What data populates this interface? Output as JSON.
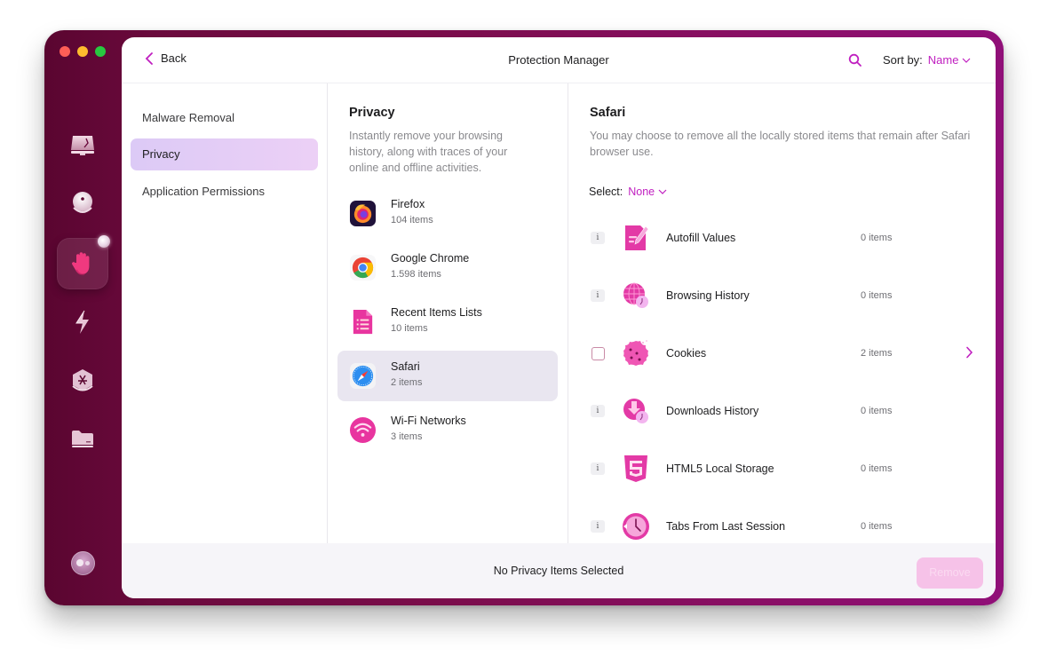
{
  "window": {
    "title": "Protection Manager",
    "accent_color": "#c01fc0"
  },
  "header": {
    "back_label": "Back",
    "title": "Protection Manager",
    "search_icon": "search-icon",
    "sort_label": "Sort by:",
    "sort_value": "Name"
  },
  "rail": {
    "items": [
      {
        "name": "cleanup",
        "icon": "disk-cleanup-icon"
      },
      {
        "name": "protection",
        "icon": "shield-scan-icon"
      },
      {
        "name": "privacy",
        "icon": "hand-icon",
        "active": true
      },
      {
        "name": "performance",
        "icon": "lightning-icon"
      },
      {
        "name": "applications",
        "icon": "app-store-icon"
      },
      {
        "name": "files",
        "icon": "folder-icon"
      }
    ],
    "assistant_icon": "assistant-icon"
  },
  "nav": {
    "items": [
      {
        "label": "Malware Removal"
      },
      {
        "label": "Privacy",
        "active": true
      },
      {
        "label": "Application Permissions"
      }
    ]
  },
  "list": {
    "title": "Privacy",
    "description": "Instantly remove your browsing history, along with traces of your online and offline activities.",
    "apps": [
      {
        "name": "Firefox",
        "count": "104 items",
        "icon": "firefox-icon"
      },
      {
        "name": "Google Chrome",
        "count": "1.598 items",
        "icon": "chrome-icon"
      },
      {
        "name": "Recent Items Lists",
        "count": "10 items",
        "icon": "recent-items-icon"
      },
      {
        "name": "Safari",
        "count": "2 items",
        "icon": "safari-icon",
        "active": true
      },
      {
        "name": "Wi-Fi Networks",
        "count": "3 items",
        "icon": "wifi-icon"
      }
    ]
  },
  "detail": {
    "title": "Safari",
    "description": "You may choose to remove all the locally stored items that remain after Safari browser use.",
    "select_label": "Select:",
    "select_value": "None",
    "categories": [
      {
        "name": "Autofill Values",
        "count": "0 items",
        "control": "info",
        "icon": "autofill-icon"
      },
      {
        "name": "Browsing History",
        "count": "0 items",
        "control": "info",
        "icon": "browsing-history-icon"
      },
      {
        "name": "Cookies",
        "count": "2 items",
        "control": "checkbox",
        "checked": false,
        "icon": "cookie-icon",
        "has_detail": true
      },
      {
        "name": "Downloads History",
        "count": "0 items",
        "control": "info",
        "icon": "downloads-history-icon"
      },
      {
        "name": "HTML5 Local Storage",
        "count": "0 items",
        "control": "info",
        "icon": "html5-icon"
      },
      {
        "name": "Tabs From Last Session",
        "count": "0 items",
        "control": "info",
        "icon": "tabs-session-icon"
      }
    ],
    "info_glyph": "i"
  },
  "footer": {
    "status": "No Privacy Items Selected",
    "remove_label": "Remove",
    "remove_enabled": false
  }
}
